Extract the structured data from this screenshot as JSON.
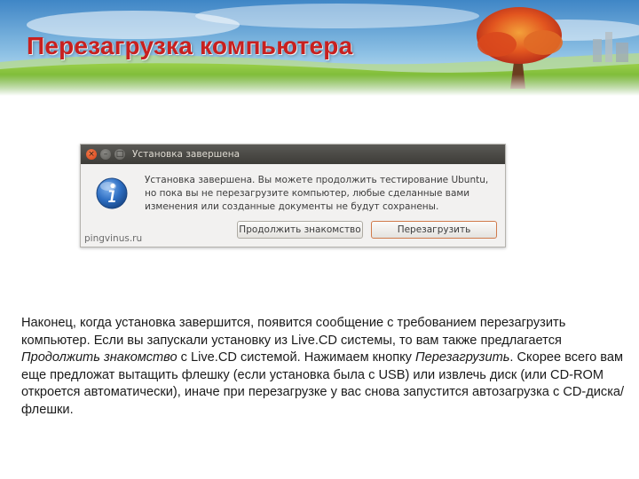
{
  "slide": {
    "title": "Перезагрузка компьютера"
  },
  "dialog": {
    "window_title": "Установка завершена",
    "message": "Установка завершена. Вы можете продолжить тестирование Ubuntu, но пока вы не перезагрузите компьютер, любые сделанные вами изменения или созданные документы не будут сохранены.",
    "continue_button_label": "Продолжить знакомство",
    "restart_button_label": "Перезагрузить",
    "watermark": "pingvinus.ru",
    "icon": "info-icon",
    "close_glyph": "×",
    "min_glyph": "–",
    "max_glyph": "□"
  },
  "body": {
    "p1": "Наконец, когда установка завершится, появится сообщение с требованием перезагрузить компьютер. Если вы запускали установку из Live.CD системы, то вам также предлагается ",
    "p1_italic": "Продолжить знакомство",
    "p2": " с Live.CD системой. Нажимаем кнопку ",
    "p2_italic": "Перезагрузить",
    "p3": ". Скорее всего вам еще предложат вытащить флешку (если установка была с USB) или извлечь диск (или CD-ROM откроется автоматически), иначе при перезагрузке у вас снова запустится автозагрузка с CD-диска/флешки."
  },
  "colors": {
    "title_red": "#c8201f",
    "ubuntu_titlebar": "#3d3c38",
    "ubuntu_orange": "#d8431a",
    "info_blue": "#2d6ec2"
  }
}
